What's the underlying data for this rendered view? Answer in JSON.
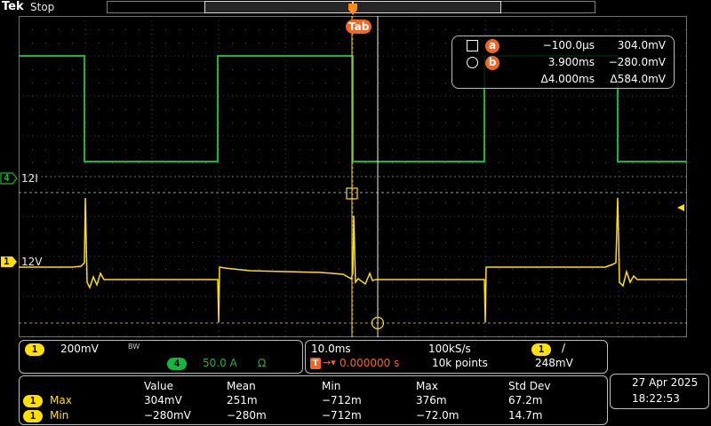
{
  "header": {
    "brand": "Tek",
    "run_state": "Stop"
  },
  "trigger_marker": {
    "label": "T",
    "cursor_flag": "ab"
  },
  "channels": {
    "ch4": {
      "number": "4",
      "label": "12I",
      "color": "#11b83a"
    },
    "ch1": {
      "number": "1",
      "label": "12V",
      "color": "#ffe000"
    }
  },
  "cursors": {
    "a": {
      "chip": "a",
      "time": "−100.0µs",
      "volt": "304.0mV"
    },
    "b": {
      "chip": "b",
      "time": "3.900ms",
      "volt": "−280.0mV"
    },
    "delta": {
      "time": "Δ4.000ms",
      "volt": "Δ584.0mV"
    }
  },
  "vertical_panel": {
    "ch1_number": "1",
    "ch1_scale": "200mV",
    "ch1_bw": "BW",
    "ch4_number": "4",
    "ch4_scale": "50.0 A",
    "ch4_unit": "Ω"
  },
  "horizontal_panel": {
    "timebase": "10.0ms",
    "sample_rate": "100kS/s",
    "trig_channel": "1",
    "trig_slope": "/",
    "trig_icon": "T",
    "trig_delay": "0.000000 s",
    "record_length": "10k points",
    "trig_level": "248mV"
  },
  "measurements": {
    "headers": [
      "Value",
      "Mean",
      "Min",
      "Max",
      "Std Dev"
    ],
    "rows": [
      {
        "ch": "1",
        "name": "Max",
        "value": "304mV",
        "mean": "251m",
        "min": "−712m",
        "max": "376m",
        "std": "67.2m"
      },
      {
        "ch": "1",
        "name": "Min",
        "value": "−280mV",
        "mean": "−280m",
        "min": "−712m",
        "max": "−72.0m",
        "std": "14.7m"
      }
    ]
  },
  "datetime": {
    "date": "27 Apr  2025",
    "time": "18:22:53"
  },
  "colors": {
    "ch1": "#ffe000",
    "ch4": "#11b83a",
    "cursor_chip": "#f26522",
    "grid": "#5a5a5a"
  }
}
